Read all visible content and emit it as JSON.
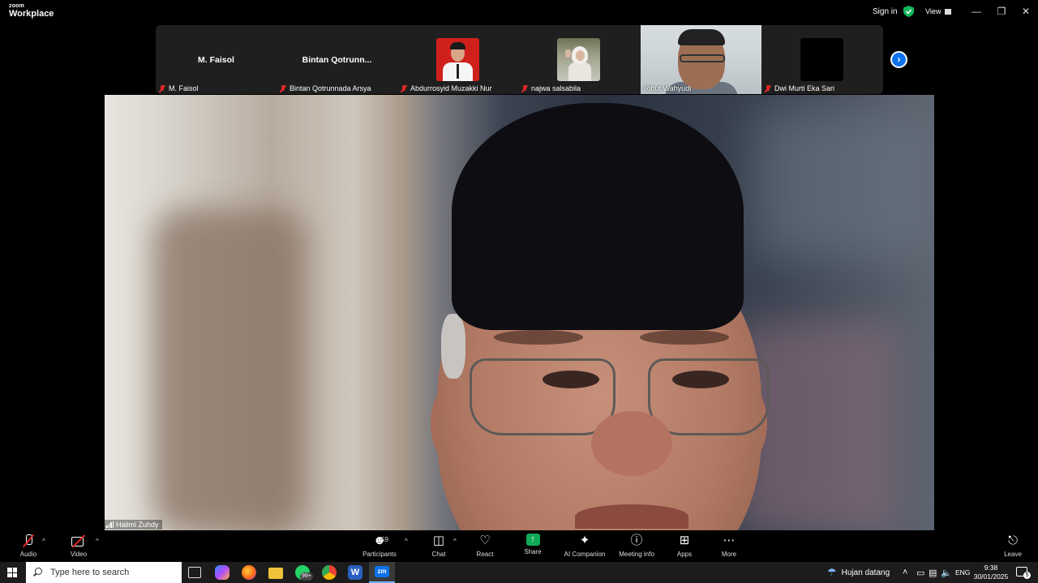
{
  "titlebar": {
    "logo_top": "zoom",
    "logo_bottom": "Workplace",
    "signin": "Sign in",
    "view": "View",
    "controls": [
      "—",
      "❐",
      "✕"
    ]
  },
  "gallery": {
    "tiles": [
      {
        "big_name": "M. Faisol",
        "label": "M. Faisol",
        "muted": true
      },
      {
        "big_name": "Bintan  Qotrunn...",
        "label": "Bintan Qotrunnada Arsya",
        "muted": true
      },
      {
        "label": "Abdurrosyid Muzakki Nur",
        "muted": true
      },
      {
        "label": "najwa salsabila",
        "muted": true
      },
      {
        "label": "Ribut Wahyudi",
        "muted": false
      },
      {
        "label": "Dwi Murti Eka Sari",
        "muted": true
      }
    ],
    "next": "›"
  },
  "speaker": {
    "name": "Halimi Zuhdy"
  },
  "toolbar": {
    "audio": "Audio",
    "video": "Video",
    "participants": "Participants",
    "participants_count": "59",
    "chat": "Chat",
    "react": "React",
    "share": "Share",
    "ai_companion": "AI Companion",
    "meeting_info": "Meeting info",
    "apps": "Apps",
    "more": "More",
    "leave": "Leave",
    "caret": "^"
  },
  "taskbar": {
    "search_placeholder": "Type here to search",
    "weather": "Hujan datang",
    "lang": "ENG",
    "time": "9:38",
    "date": "30/01/2025",
    "notifications": "5",
    "whatsapp_badge": "99+"
  },
  "colors": {
    "accent": "#0e72ed",
    "muted_red": "#e02828",
    "share_green": "#0fa958",
    "shield_green": "#12b85a"
  }
}
